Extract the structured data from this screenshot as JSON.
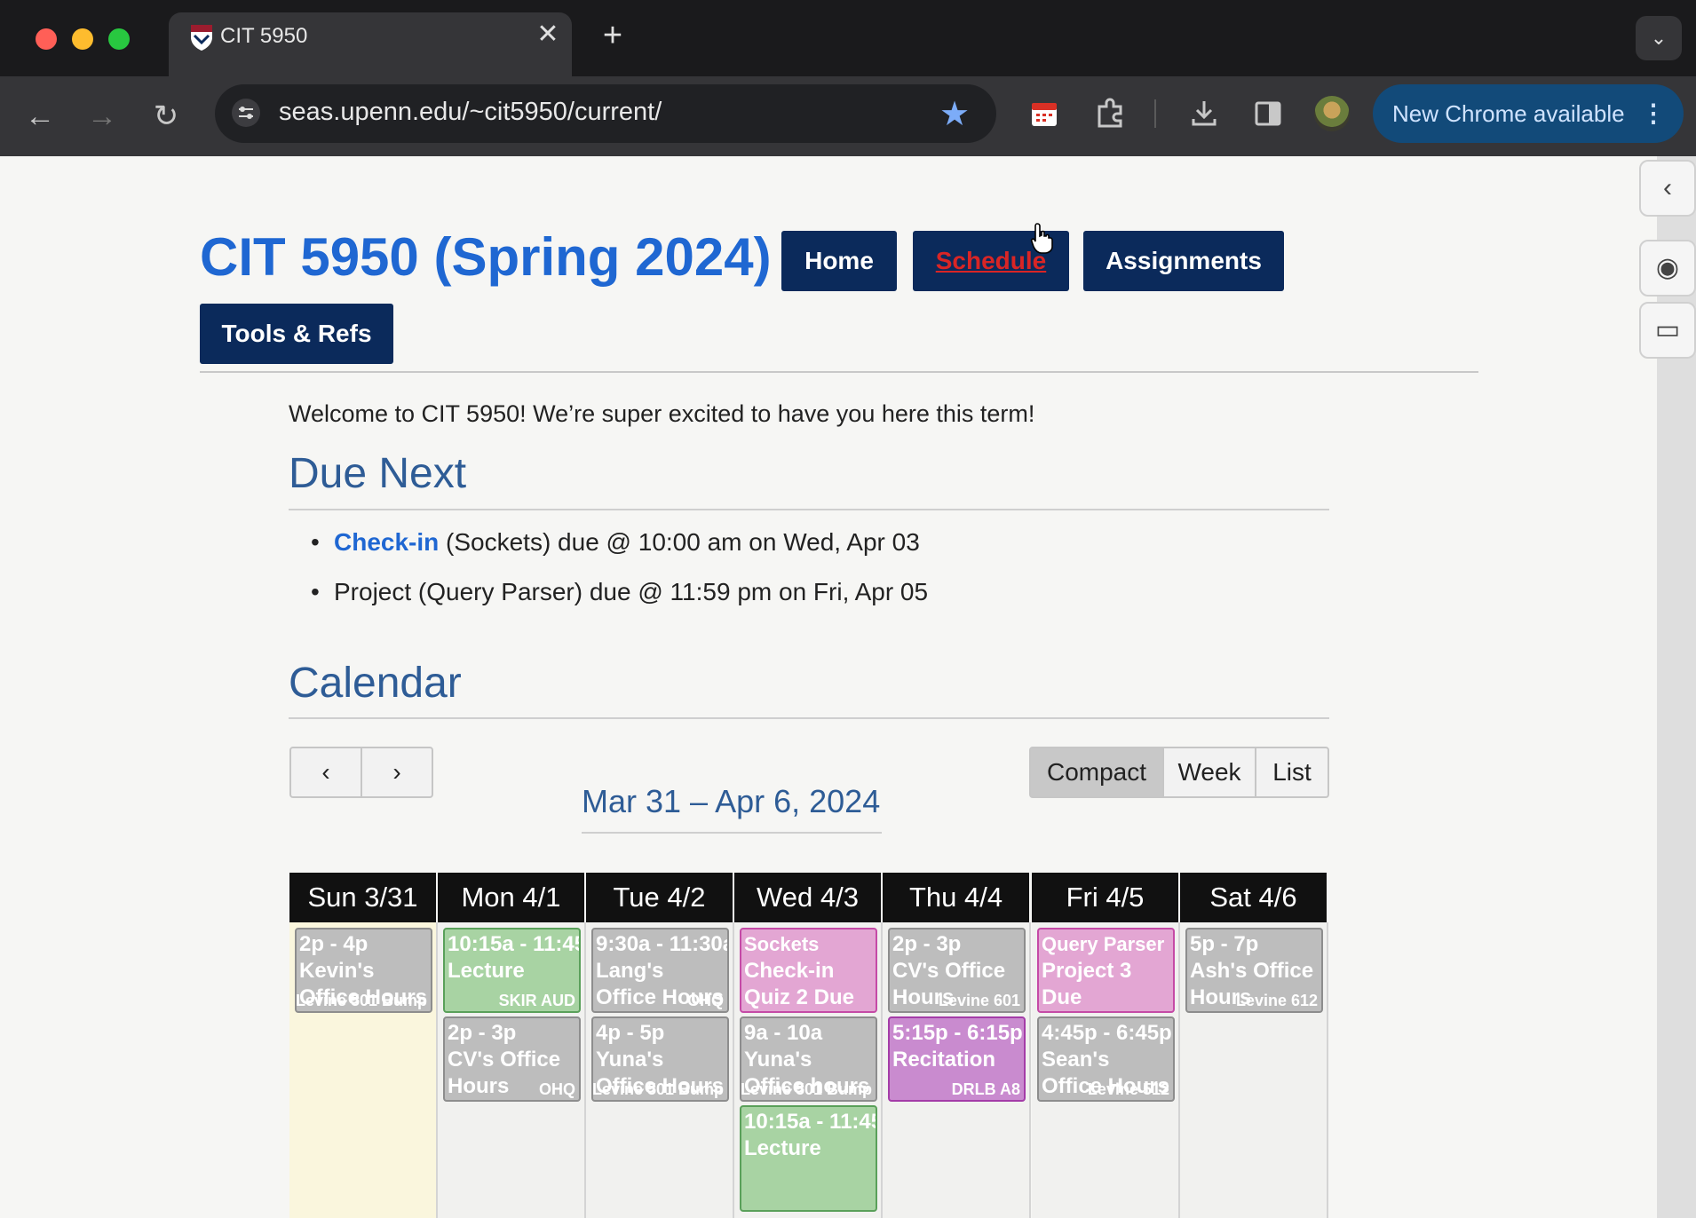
{
  "browser": {
    "tab_title": "CIT 5950",
    "url": "seas.upenn.edu/~cit5950/current/",
    "update_label": "New Chrome available",
    "icons": [
      "back-icon",
      "forward-icon",
      "reload-icon",
      "tune-icon",
      "star-icon",
      "calendar-ext-icon",
      "extensions-icon",
      "download-icon",
      "sidepanel-icon",
      "avatar"
    ]
  },
  "header": {
    "title": "CIT 5950 (Spring 2024)",
    "nav": [
      {
        "label": "Home"
      },
      {
        "label": "Schedule"
      },
      {
        "label": "Assignments"
      },
      {
        "label": "Tools & Refs"
      }
    ]
  },
  "welcome": "Welcome to CIT 5950! We’re super excited to have you here this term!",
  "due_next": {
    "heading": "Due Next",
    "items": [
      {
        "link": "Check-in",
        "text": " (Sockets) due @ 10:00 am on Wed, Apr 03"
      },
      {
        "link": "",
        "text": "Project (Query Parser) due @ 11:59 pm on Fri, Apr 05"
      }
    ]
  },
  "calendar": {
    "heading": "Calendar",
    "prev_label": "‹",
    "next_label": "›",
    "range": "Mar 31 – Apr 6, 2024",
    "views": [
      "Compact",
      "Week",
      "List"
    ],
    "active_view": "Compact",
    "days": [
      {
        "label": "Sun 3/31",
        "events": [
          {
            "time": "2p - 4p",
            "title": "Kevin's Office Hours",
            "loc": "Levine 501 Bump",
            "color": "gray"
          }
        ]
      },
      {
        "label": "Mon 4/1",
        "events": [
          {
            "time": "10:15a - 11:45",
            "title": "Lecture",
            "loc": "SKIR AUD",
            "color": "green"
          },
          {
            "time": "2p - 3p",
            "title": "CV's Office Hours",
            "loc": "OHQ",
            "color": "gray"
          }
        ]
      },
      {
        "label": "Tue 4/2",
        "events": [
          {
            "time": "9:30a - 11:30a",
            "title": "Lang's Office Hours",
            "loc": "OHQ",
            "color": "gray"
          },
          {
            "time": "4p - 5p",
            "title": "Yuna's Office Hours",
            "loc": "Levine 501 Bump",
            "color": "gray"
          }
        ]
      },
      {
        "label": "Wed 4/3",
        "events": [
          {
            "time": "Sockets",
            "title": "Check-in Quiz 2 Due",
            "loc": "",
            "color": "pink"
          },
          {
            "time": "9a - 10a",
            "title": "Yuna's Office hours",
            "loc": "Levine 501 Bump",
            "color": "gray"
          },
          {
            "time": "10:15a - 11:45",
            "title": "Lecture",
            "loc": "",
            "color": "green"
          }
        ]
      },
      {
        "label": "Thu 4/4",
        "events": [
          {
            "time": "2p - 3p",
            "title": "CV's Office Hours",
            "loc": "Levine 601",
            "color": "gray"
          },
          {
            "time": "5:15p - 6:15p",
            "title": "Recitation",
            "loc": "DRLB A8",
            "color": "purple"
          }
        ]
      },
      {
        "label": "Fri 4/5",
        "events": [
          {
            "time": "Query Parser",
            "title": "Project 3 Due",
            "loc": "",
            "color": "pink"
          },
          {
            "time": "4:45p - 6:45p",
            "title": "Sean's Office Hours",
            "loc": "Levine 512",
            "color": "gray"
          }
        ]
      },
      {
        "label": "Sat 4/6",
        "events": [
          {
            "time": "5p - 7p",
            "title": "Ash's Office Hours",
            "loc": "Levine 612",
            "color": "gray"
          }
        ]
      }
    ]
  },
  "colors": {
    "title_blue": "#1f67d2",
    "nav_navy": "#0b2a5b",
    "heading_blue": "#2e5c96",
    "today_bg": "#faf6dd"
  }
}
